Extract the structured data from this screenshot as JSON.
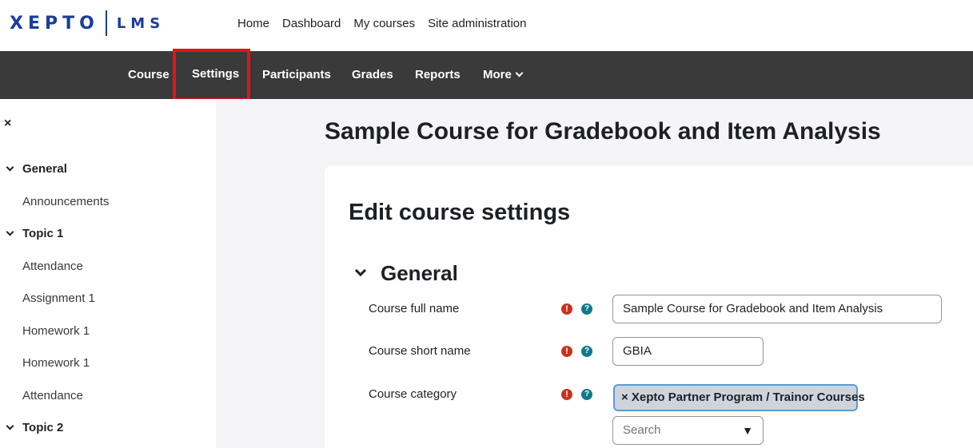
{
  "brand": {
    "logo": "XEPTO",
    "suffix": "LMS"
  },
  "topnav": [
    "Home",
    "Dashboard",
    "My courses",
    "Site administration"
  ],
  "secnav": {
    "course": "Course",
    "settings": "Settings",
    "participants": "Participants",
    "grades": "Grades",
    "reports": "Reports",
    "more": "More"
  },
  "drawer": {
    "close_icon": "×",
    "items": [
      {
        "type": "section",
        "label": "General"
      },
      {
        "type": "item",
        "label": "Announcements"
      },
      {
        "type": "section",
        "label": "Topic 1"
      },
      {
        "type": "item",
        "label": "Attendance"
      },
      {
        "type": "item",
        "label": "Assignment 1"
      },
      {
        "type": "item",
        "label": "Homework 1"
      },
      {
        "type": "item",
        "label": "Homework 1"
      },
      {
        "type": "item",
        "label": "Attendance"
      },
      {
        "type": "section",
        "label": "Topic 2"
      }
    ]
  },
  "page": {
    "title": "Sample Course for Gradebook and Item Analysis",
    "card_title": "Edit course settings",
    "section_title": "General"
  },
  "form": {
    "full_name": {
      "label": "Course full name",
      "value": "Sample Course for Gradebook and Item Analysis"
    },
    "short_name": {
      "label": "Course short name",
      "value": "GBIA"
    },
    "category": {
      "label": "Course category",
      "selected": "× Xepto Partner Program / Trainor Courses",
      "search_placeholder": "Search"
    }
  },
  "icons": {
    "required": "!",
    "help": "?",
    "caret": "▼"
  },
  "colors": {
    "secnav_bg": "#3a3a3a",
    "highlight": "#e0141e",
    "brand": "#1a3d9c",
    "required": "#ca3120",
    "help": "#0e7a8a"
  }
}
